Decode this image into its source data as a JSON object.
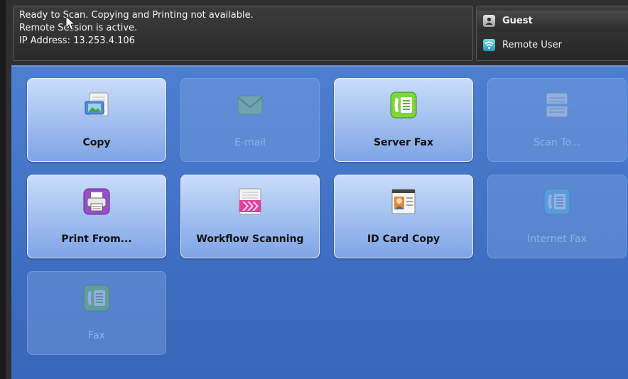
{
  "status": {
    "line1": "Ready to Scan.  Copying and Printing not available.",
    "line2": "Remote Session is active.",
    "line3": "IP Address: 13.253.4.106"
  },
  "user": {
    "name": "Guest",
    "session": "Remote User"
  },
  "tiles": [
    {
      "label": "Copy",
      "enabled": true,
      "icon": "copy-icon"
    },
    {
      "label": "E-mail",
      "enabled": false,
      "icon": "email-icon"
    },
    {
      "label": "Server Fax",
      "enabled": true,
      "icon": "server-fax-icon"
    },
    {
      "label": "Scan To...",
      "enabled": false,
      "icon": "scan-to-icon"
    },
    {
      "label": "Print From...",
      "enabled": true,
      "icon": "print-from-icon"
    },
    {
      "label": "Workflow Scanning",
      "enabled": true,
      "icon": "workflow-scanning-icon"
    },
    {
      "label": "ID Card Copy",
      "enabled": true,
      "icon": "id-card-icon"
    },
    {
      "label": "Internet Fax",
      "enabled": false,
      "icon": "internet-fax-icon"
    },
    {
      "label": "Fax",
      "enabled": false,
      "icon": "fax-icon"
    }
  ],
  "colors": {
    "accent_blue": "#4d7fd0",
    "tile_enabled": "#a6c3f0",
    "tile_disabled": "#6e95d8"
  }
}
